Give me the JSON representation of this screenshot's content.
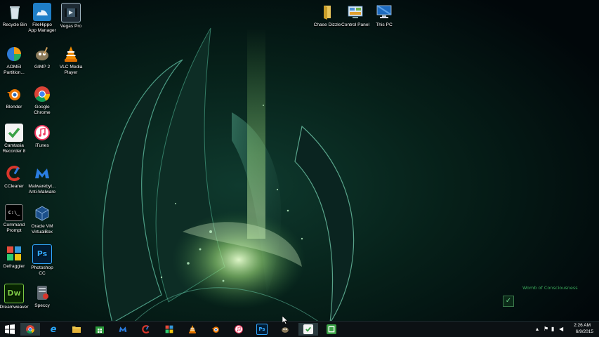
{
  "desktop": {
    "icons": [
      {
        "label": "Recycle Bin",
        "icon": "recycle-bin-icon"
      },
      {
        "label": "FileHippo\nApp Manager",
        "icon": "filehippo-icon"
      },
      {
        "label": "Vegas Pro",
        "icon": "vegas-pro-icon"
      },
      {
        "label": "AOMEI\nPartition...",
        "icon": "aomei-icon"
      },
      {
        "label": "GIMP 2",
        "icon": "gimp-icon"
      },
      {
        "label": "VLC Media\nPlayer",
        "icon": "vlc-icon"
      },
      {
        "label": "Blender",
        "icon": "blender-icon"
      },
      {
        "label": "Google\nChrome",
        "icon": "chrome-icon"
      },
      {
        "label": "Camtasia\nRecorder 8",
        "icon": "camtasia-icon"
      },
      {
        "label": "iTunes",
        "icon": "itunes-icon"
      },
      {
        "label": "CCleaner",
        "icon": "ccleaner-icon"
      },
      {
        "label": "Malwarebyt...\nAnti-Malware",
        "icon": "malwarebytes-icon"
      },
      {
        "label": "Command\nPrompt",
        "icon": "cmd-icon"
      },
      {
        "label": "Oracle VM\nVirtualBox",
        "icon": "virtualbox-icon"
      },
      {
        "label": "Defraggler",
        "icon": "defraggler-icon"
      },
      {
        "label": "Photoshop\nCC",
        "icon": "photoshop-icon",
        "glyph": "Ps"
      },
      {
        "label": "Dreamweaver",
        "icon": "dreamweaver-icon",
        "glyph": "Dw"
      },
      {
        "label": "Speccy",
        "icon": "speccy-icon"
      },
      {
        "label": "Chase Dizzle",
        "icon": "folder-icon"
      },
      {
        "label": "Control Panel",
        "icon": "control-panel-icon"
      },
      {
        "label": "This PC",
        "icon": "this-pc-icon"
      }
    ],
    "wallpaper_caption": "Womb of Consciousness",
    "accent_color": "#3aa65a"
  },
  "taskbar": {
    "start": {
      "icon": "windows-logo-icon"
    },
    "pinned": [
      {
        "icon": "chrome-icon",
        "active": true
      },
      {
        "icon": "internet-explorer-icon"
      },
      {
        "icon": "file-explorer-icon"
      },
      {
        "icon": "store-icon"
      },
      {
        "icon": "malwarebytes-icon"
      },
      {
        "icon": "ccleaner-icon"
      },
      {
        "icon": "defraggler-icon"
      },
      {
        "icon": "vlc-icon"
      },
      {
        "icon": "blender-icon"
      },
      {
        "icon": "itunes-icon"
      },
      {
        "icon": "photoshop-icon",
        "glyph": "Ps"
      },
      {
        "icon": "gimp-icon"
      },
      {
        "icon": "camtasia-icon",
        "active": true
      },
      {
        "icon": "camtasia-studio-icon"
      }
    ],
    "tray": {
      "time": "2:26 AM",
      "date": "6/9/2015",
      "icons": [
        "show-hidden-icon",
        "flag-icon",
        "network-icon",
        "volume-icon"
      ]
    }
  }
}
